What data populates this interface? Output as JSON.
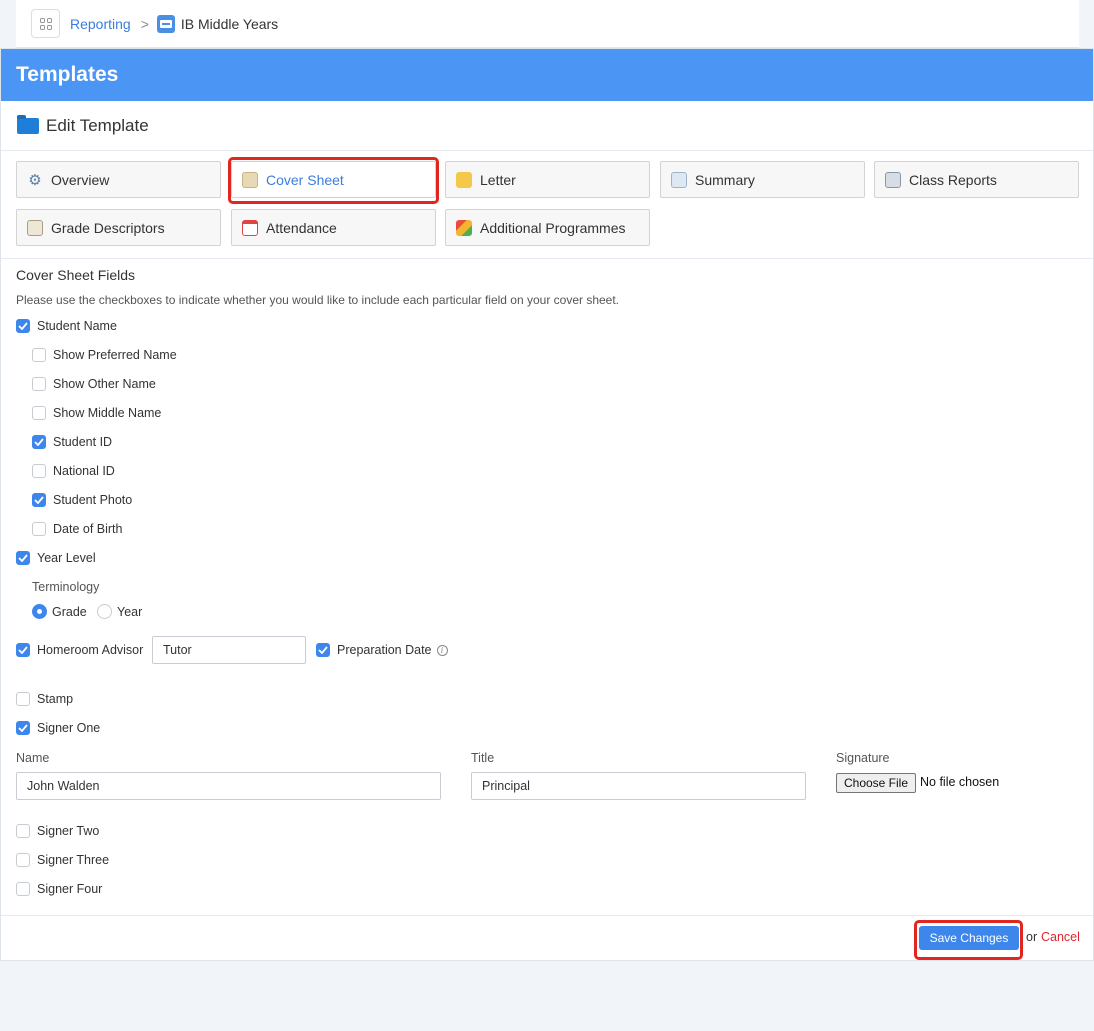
{
  "breadcrumb": {
    "reporting": "Reporting",
    "separator": ">",
    "current": "IB Middle Years"
  },
  "header": {
    "title": "Templates"
  },
  "subheader": {
    "title": "Edit Template"
  },
  "tabs": [
    {
      "label": "Overview",
      "icon": "gear-icon"
    },
    {
      "label": "Cover Sheet",
      "icon": "cover-sheet-icon",
      "active": true
    },
    {
      "label": "Letter",
      "icon": "envelope-icon"
    },
    {
      "label": "Summary",
      "icon": "summary-icon"
    },
    {
      "label": "Class Reports",
      "icon": "class-reports-icon"
    },
    {
      "label": "Grade Descriptors",
      "icon": "grade-descriptors-icon"
    },
    {
      "label": "Attendance",
      "icon": "calendar-icon"
    },
    {
      "label": "Additional Programmes",
      "icon": "puzzle-icon"
    }
  ],
  "fields": {
    "title": "Cover Sheet Fields",
    "description": "Please use the checkboxes to indicate whether you would like to include each particular field on your cover sheet.",
    "student_name": {
      "label": "Student Name",
      "checked": true
    },
    "show_preferred_name": {
      "label": "Show Preferred Name",
      "checked": false
    },
    "show_other_name": {
      "label": "Show Other Name",
      "checked": false
    },
    "show_middle_name": {
      "label": "Show Middle Name",
      "checked": false
    },
    "student_id": {
      "label": "Student ID",
      "checked": true
    },
    "national_id": {
      "label": "National ID",
      "checked": false
    },
    "student_photo": {
      "label": "Student Photo",
      "checked": true
    },
    "date_of_birth": {
      "label": "Date of Birth",
      "checked": false
    },
    "year_level": {
      "label": "Year Level",
      "checked": true
    },
    "terminology": {
      "label": "Terminology",
      "options": [
        "Grade",
        "Year"
      ],
      "selected": "Grade"
    },
    "homeroom_advisor": {
      "label": "Homeroom Advisor",
      "checked": true,
      "value": "Tutor"
    },
    "preparation_date": {
      "label": "Preparation Date",
      "checked": true,
      "info": "i"
    },
    "stamp": {
      "label": "Stamp",
      "checked": false
    },
    "signer_one": {
      "label": "Signer One",
      "checked": true
    },
    "signer": {
      "name_label": "Name",
      "name_value": "John Walden",
      "title_label": "Title",
      "title_value": "Principal",
      "signature_label": "Signature",
      "choose_file": "Choose File",
      "no_file": "No file chosen"
    },
    "signer_two": {
      "label": "Signer Two",
      "checked": false
    },
    "signer_three": {
      "label": "Signer Three",
      "checked": false
    },
    "signer_four": {
      "label": "Signer Four",
      "checked": false
    }
  },
  "footer": {
    "save": "Save Changes",
    "or": "or",
    "cancel": "Cancel"
  },
  "colors": {
    "header_bg": "#4b95f4",
    "accent": "#3d86ec",
    "highlight": "#e0261e",
    "cancel": "#e0262c"
  }
}
